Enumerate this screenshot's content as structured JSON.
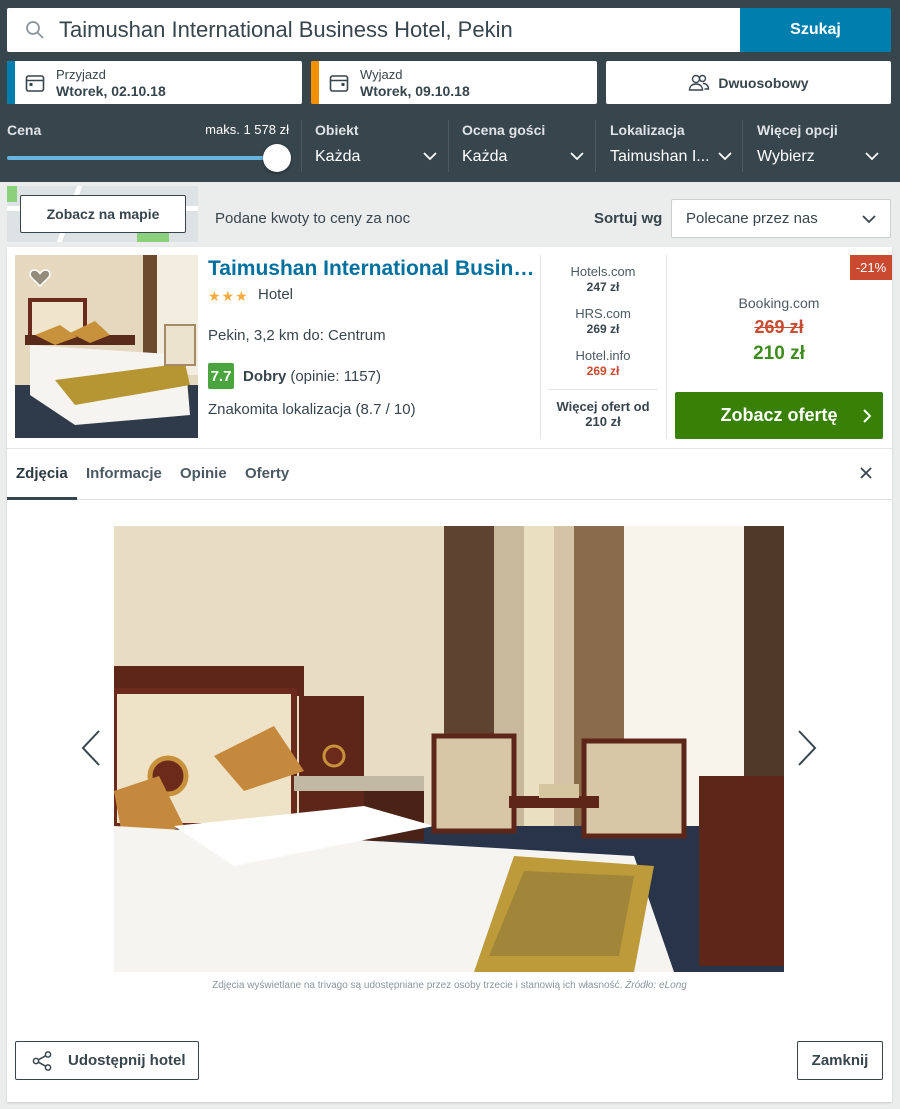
{
  "search": {
    "query": "Taimushan International Business Hotel, Pekin",
    "button": "Szukaj"
  },
  "dates": {
    "checkin_label": "Przyjazd",
    "checkin_value": "Wtorek, 02.10.18",
    "checkout_label": "Wyjazd",
    "checkout_value": "Wtorek, 09.10.18"
  },
  "room": {
    "label": "Dwuosobowy"
  },
  "filters": {
    "price_label": "Cena",
    "price_max": "maks. 1 578 zł",
    "price_slider_fraction": 1.0,
    "items": [
      {
        "label": "Obiekt",
        "value": "Każda"
      },
      {
        "label": "Ocena gości",
        "value": "Każda"
      },
      {
        "label": "Lokalizacja",
        "value": "Taimushan I..."
      },
      {
        "label": "Więcej opcji",
        "value": "Wybierz"
      }
    ]
  },
  "toolbar": {
    "map_button": "Zobacz na mapie",
    "price_note": "Podane kwoty to ceny za noc",
    "sort_label": "Sortuj wg",
    "sort_value": "Polecane przez nas"
  },
  "hotel": {
    "name": "Taimushan International Business Hotel",
    "stars": "★★★",
    "type": "Hotel",
    "location": "Pekin, 3,2 km do: Centrum",
    "rating_score": "7.7",
    "rating_word": "Dobry",
    "rating_count": "(opinie: 1157)",
    "extra": "Znakomita lokalizacja (8.7 / 10)"
  },
  "offers": {
    "list": [
      {
        "partner": "Hotels.com",
        "price": "247 zł",
        "price_color": "#37454d"
      },
      {
        "partner": "HRS.com",
        "price": "269 zł",
        "price_color": "#37454d"
      },
      {
        "partner": "Hotel.info",
        "price": "269 zł",
        "price_color": "#c94a30"
      }
    ],
    "more_line1": "Więcej ofert od",
    "more_line2": "210 zł",
    "discount": "-21%",
    "best_partner": "Booking.com",
    "old_price": "269 zł",
    "new_price": "210 zł",
    "deal_button": "Zobacz ofertę"
  },
  "tabs": [
    "Zdjęcia",
    "Informacje",
    "Opinie",
    "Oferty"
  ],
  "gallery": {
    "credit": "Zdjęcia wyświetlane na trivago są udostępniane przez osoby trzecie i stanowią ich własność.",
    "credit_source": "Źródło: eLong"
  },
  "footer": {
    "share_button": "Udostępnij hotel",
    "close_button": "Zamknij"
  },
  "colors": {
    "header_bg": "#37454d",
    "search_button": "#007faf",
    "checkin_accent": "#007faf",
    "checkout_accent": "#f48f00",
    "deal_button": "#398006",
    "rating_badge": "#4aa53e",
    "discount_badge": "#c94a30"
  }
}
